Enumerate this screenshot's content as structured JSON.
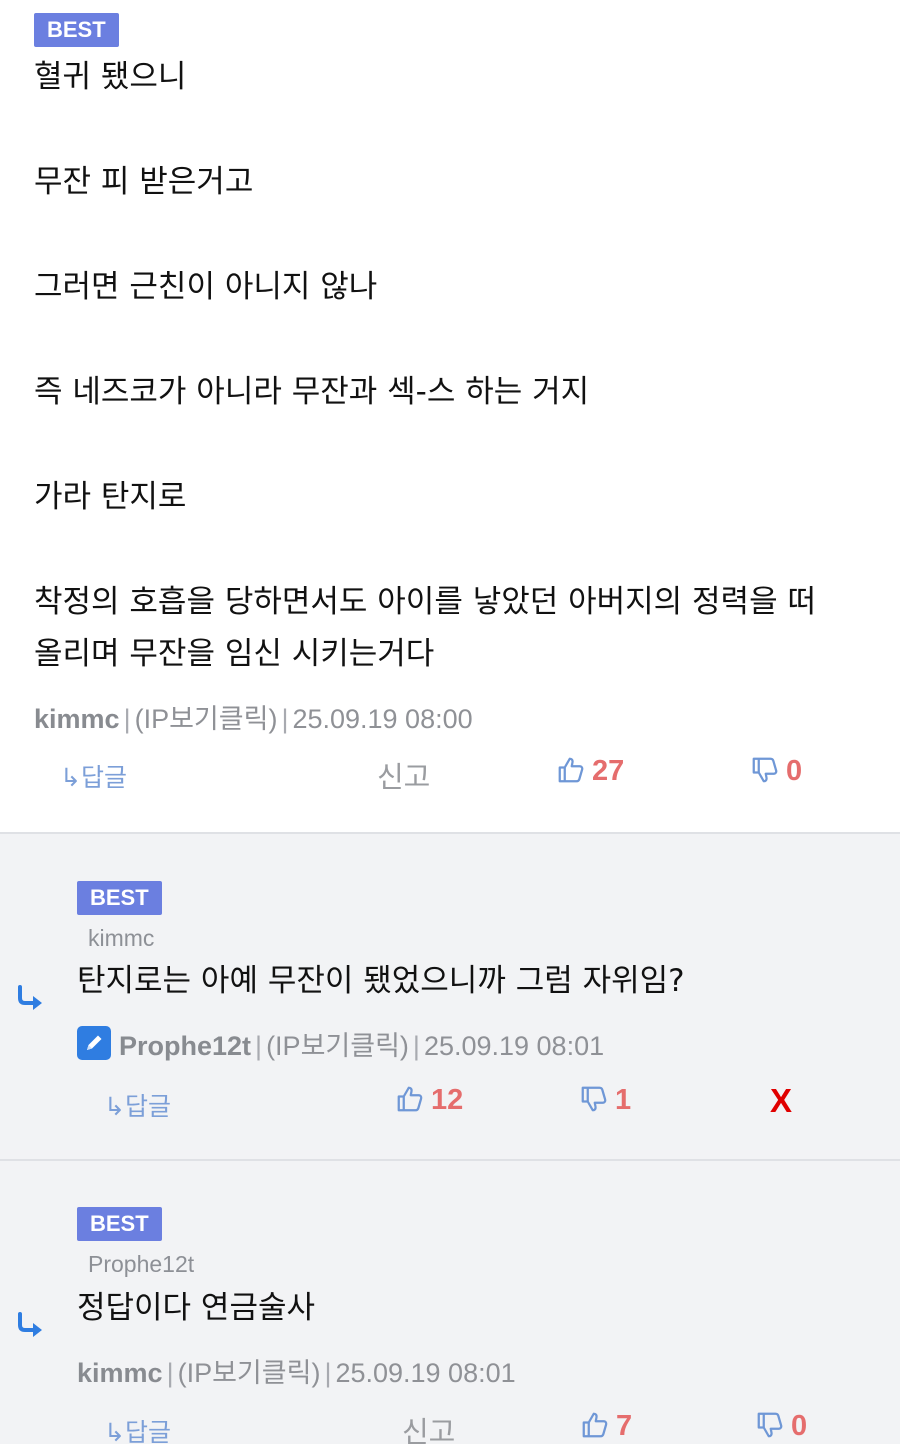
{
  "comments": [
    {
      "badge": "BEST",
      "paragraphs": [
        "혈귀 됐으니",
        "무잔 피 받은거고",
        "그러면 근친이 아니지 않나",
        "즉 네즈코가 아니라 무잔과 섹-스 하는 거지",
        "가라 탄지로",
        "착정의 호흡을 당하면서도 아이를 낳았던 아버지의 정력을 떠",
        "올리며 무잔을 임신 시키는거다"
      ],
      "author": "kimmc",
      "ip_label": "(IP보기클릭)",
      "timestamp": "25.09.19 08:00",
      "reply_label": "↳답글",
      "report_label": "신고",
      "likes": "27",
      "dislikes": "0"
    },
    {
      "badge": "BEST",
      "parent": "kimmc",
      "text": "탄지로는 아예 무잔이 됐었으니까 그럼 자위임?",
      "author": "Prophe12t",
      "ip_label": "(IP보기클릭)",
      "timestamp": "25.09.19 08:01",
      "reply_label": "↳답글",
      "likes": "12",
      "dislikes": "1",
      "delete_label": "X"
    },
    {
      "badge": "BEST",
      "parent": "Prophe12t",
      "text": "정답이다 연금술사",
      "author": "kimmc",
      "ip_label": "(IP보기클릭)",
      "timestamp": "25.09.19 08:01",
      "reply_label": "↳답글",
      "report_label": "신고",
      "likes": "7",
      "dislikes": "0"
    }
  ],
  "separator": "|",
  "colors": {
    "badge": "#6b7fe0",
    "vote": "#e56d6d",
    "reply_background": "#f2f3f5",
    "reply_arrow": "#2f7de1",
    "delete": "#e00000"
  }
}
